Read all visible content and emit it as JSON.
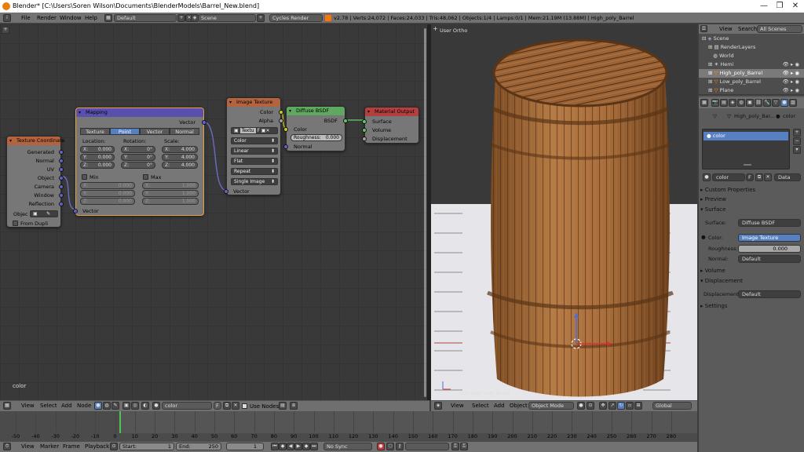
{
  "window": {
    "title": "Blender* [C:\\Users\\Soren Wilson\\Documents\\BlenderModels\\Barrel_New.blend]",
    "minimize": "—",
    "maximize": "❐",
    "close": "✕"
  },
  "topbar": {
    "menus": [
      "File",
      "Render",
      "Window",
      "Help"
    ],
    "layout": "Default",
    "scene": "Scene",
    "engine": "Cycles Render",
    "stats": "v2.78 | Verts:24,072 | Faces:24,033 | Tris:48,062 | Objects:1/4 | Lamps:0/1 | Mem:21.19M (13.88M) | High_poly_Barrel"
  },
  "node_editor": {
    "label": "color",
    "texcoord": {
      "title": "Texture Coordinate",
      "outputs": [
        "Generated",
        "Normal",
        "UV",
        "Object",
        "Camera",
        "Window",
        "Reflection"
      ],
      "object_label": "Objec",
      "from_dupli": "From Dupli"
    },
    "mapping": {
      "title": "Mapping",
      "output": "Vector",
      "tabs": [
        "Texture",
        "Point",
        "Vector",
        "Normal"
      ],
      "active_tab": "Point",
      "cols": [
        "Location:",
        "Rotation:",
        "Scale:"
      ],
      "location": [
        {
          "axis": "X:",
          "value": "0.000"
        },
        {
          "axis": "Y:",
          "value": "0.000"
        },
        {
          "axis": "Z:",
          "value": "0.000"
        }
      ],
      "rotation": [
        {
          "axis": "X:",
          "value": "0°"
        },
        {
          "axis": "Y:",
          "value": "0°"
        },
        {
          "axis": "Z:",
          "value": "0°"
        }
      ],
      "scale": [
        {
          "axis": "X:",
          "value": "4.000"
        },
        {
          "axis": "Y:",
          "value": "4.000"
        },
        {
          "axis": "Z:",
          "value": "4.000"
        }
      ],
      "min": "Min",
      "max": "Max",
      "min_vals": [
        {
          "axis": "X:",
          "value": "0.000"
        },
        {
          "axis": "Y:",
          "value": "0.000"
        },
        {
          "axis": "Z:",
          "value": "0.000"
        }
      ],
      "max_vals": [
        {
          "axis": "X:",
          "value": "1.000"
        },
        {
          "axis": "Y:",
          "value": "1.000"
        },
        {
          "axis": "Z:",
          "value": "1.000"
        }
      ],
      "input": "Vector"
    },
    "imagetex": {
      "title": "Image Texture",
      "outputs": [
        "Color",
        "Alpha"
      ],
      "image": "Textu",
      "image_f": "F",
      "options": [
        "Color",
        "Linear",
        "Flat",
        "Repeat",
        "Single Image"
      ],
      "input": "Vector"
    },
    "diffuse": {
      "title": "Diffuse BSDF",
      "output": "BSDF",
      "input_color": "Color",
      "roughness_label": "Roughness:",
      "roughness": "0.000",
      "input_normal": "Normal"
    },
    "matout": {
      "title": "Material Output",
      "inputs": [
        "Surface",
        "Volume",
        "Displacement"
      ]
    }
  },
  "node_header": {
    "menus": [
      "View",
      "Select",
      "Add",
      "Node"
    ],
    "material": "color",
    "f": "F",
    "use_nodes": "Use Nodes"
  },
  "viewport": {
    "label": "User Ortho",
    "object_name": "(23) High_poly_Barrel",
    "menus": [
      "View",
      "Select",
      "Add",
      "Object"
    ],
    "mode": "Object Mode",
    "orientation": "Global"
  },
  "timeline": {
    "ticks": [
      "-50",
      "-40",
      "-30",
      "-20",
      "-10",
      "0",
      "10",
      "20",
      "30",
      "40",
      "50",
      "60",
      "70",
      "80",
      "90",
      "100",
      "110",
      "120",
      "130",
      "140",
      "150",
      "160",
      "170",
      "180",
      "190",
      "200",
      "210",
      "220",
      "230",
      "240",
      "250",
      "260",
      "270",
      "280"
    ],
    "current_frame": "1",
    "menus": [
      "View",
      "Marker",
      "Frame",
      "Playback"
    ],
    "start_label": "Start:",
    "start": "1",
    "end_label": "End:",
    "end": "250",
    "sync": "No Sync"
  },
  "outliner": {
    "tabs": [
      "View",
      "Search",
      "All Scenes"
    ],
    "items": [
      "Scene",
      "RenderLayers",
      "World",
      "Hemi",
      "High_poly_Barrel",
      "Low_poly_Barrel",
      "Plane"
    ]
  },
  "properties": {
    "breadcrumb_object": "High_poly_Bar...",
    "breadcrumb_mat": "color",
    "slot": "color",
    "mat_field": "color",
    "mat_f": "F",
    "data": "Data",
    "sections": {
      "custom": "Custom Properties",
      "preview": "Preview",
      "surface": "Surface",
      "volume": "Volume",
      "displacement": "Displacement",
      "settings": "Settings"
    },
    "surface_label": "Surface:",
    "surface_value": "Diffuse BSDF",
    "color_label": "Color:",
    "color_value": "Image Texture",
    "roughness_label": "Roughness:",
    "roughness_value": "0.000",
    "normal_label": "Normal:",
    "normal_value": "Default",
    "disp_label": "Displacement:",
    "disp_value": "Default"
  }
}
